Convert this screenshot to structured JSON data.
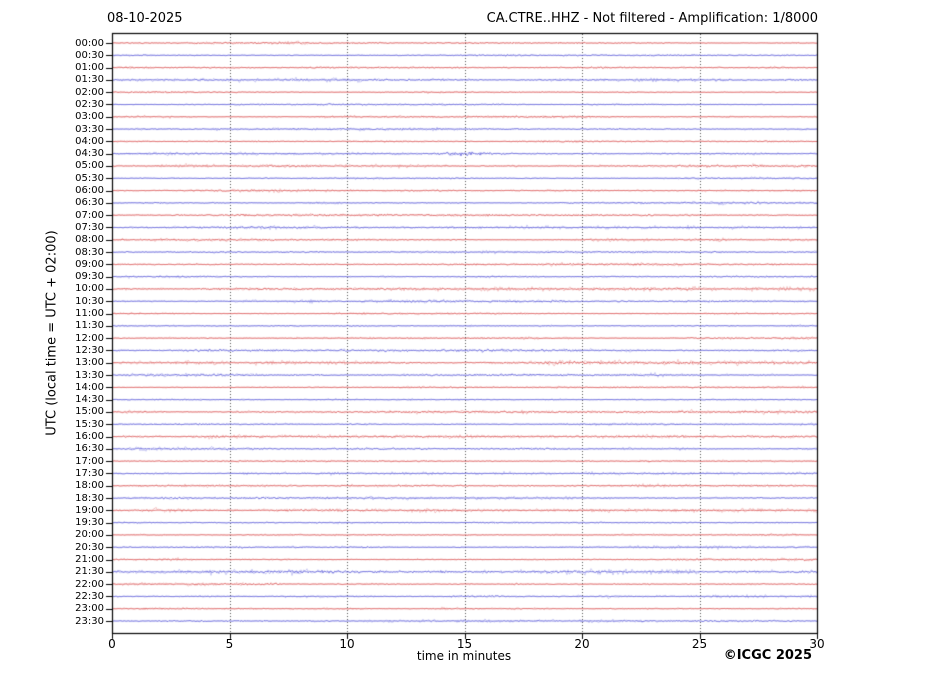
{
  "header": {
    "date": "08-10-2025",
    "station_info": "CA.CTRE..HHZ - Not filtered - Amplification: 1/8000"
  },
  "axes": {
    "y_label": "UTC (local time = UTC + 02:00)",
    "x_label": "time in minutes"
  },
  "footer": {
    "copyright": "©ICGC 2025"
  },
  "colors": {
    "trace_red": "#d94c4c",
    "trace_blue": "#5252d6",
    "grid": "#555555",
    "frame": "#000000",
    "background": "#ffffff"
  },
  "chart_data": {
    "type": "line",
    "subtype": "helicorder-dayplot",
    "x_range_minutes": [
      0,
      30
    ],
    "x_ticks": [
      0,
      5,
      10,
      15,
      20,
      25,
      30
    ],
    "grid_minutes": [
      5,
      10,
      15,
      20,
      25
    ],
    "minutes_per_row": 30,
    "legend_position": "none",
    "grid": "vertical-dotted",
    "rows": [
      {
        "label": "00:00",
        "color": "red",
        "amp": 1.0
      },
      {
        "label": "00:30",
        "color": "blue",
        "amp": 0.9
      },
      {
        "label": "01:00",
        "color": "red",
        "amp": 1.1
      },
      {
        "label": "01:30",
        "color": "blue",
        "amp": 1.25
      },
      {
        "label": "02:00",
        "color": "red",
        "amp": 1.0
      },
      {
        "label": "02:30",
        "color": "blue",
        "amp": 0.95
      },
      {
        "label": "03:00",
        "color": "red",
        "amp": 1.0
      },
      {
        "label": "03:30",
        "color": "blue",
        "amp": 1.0
      },
      {
        "label": "04:00",
        "color": "red",
        "amp": 0.95
      },
      {
        "label": "04:30",
        "color": "blue",
        "amp": 1.1
      },
      {
        "label": "05:00",
        "color": "red",
        "amp": 1.2
      },
      {
        "label": "05:30",
        "color": "blue",
        "amp": 0.8
      },
      {
        "label": "06:00",
        "color": "red",
        "amp": 1.1
      },
      {
        "label": "06:30",
        "color": "blue",
        "amp": 1.0
      },
      {
        "label": "07:00",
        "color": "red",
        "amp": 1.3
      },
      {
        "label": "07:30",
        "color": "blue",
        "amp": 1.1
      },
      {
        "label": "08:00",
        "color": "red",
        "amp": 1.05
      },
      {
        "label": "08:30",
        "color": "blue",
        "amp": 0.9
      },
      {
        "label": "09:00",
        "color": "red",
        "amp": 0.9
      },
      {
        "label": "09:30",
        "color": "blue",
        "amp": 1.0
      },
      {
        "label": "10:00",
        "color": "red",
        "amp": 1.3
      },
      {
        "label": "10:30",
        "color": "blue",
        "amp": 1.0
      },
      {
        "label": "11:00",
        "color": "red",
        "amp": 0.9
      },
      {
        "label": "11:30",
        "color": "blue",
        "amp": 1.0
      },
      {
        "label": "12:00",
        "color": "red",
        "amp": 1.0
      },
      {
        "label": "12:30",
        "color": "blue",
        "amp": 1.4
      },
      {
        "label": "13:00",
        "color": "red",
        "amp": 1.45
      },
      {
        "label": "13:30",
        "color": "blue",
        "amp": 1.1
      },
      {
        "label": "14:00",
        "color": "red",
        "amp": 0.7
      },
      {
        "label": "14:30",
        "color": "blue",
        "amp": 0.9
      },
      {
        "label": "15:00",
        "color": "red",
        "amp": 1.15
      },
      {
        "label": "15:30",
        "color": "blue",
        "amp": 1.0
      },
      {
        "label": "16:00",
        "color": "red",
        "amp": 1.1
      },
      {
        "label": "16:30",
        "color": "blue",
        "amp": 1.2
      },
      {
        "label": "17:00",
        "color": "red",
        "amp": 0.9
      },
      {
        "label": "17:30",
        "color": "blue",
        "amp": 1.0
      },
      {
        "label": "18:00",
        "color": "red",
        "amp": 1.0
      },
      {
        "label": "18:30",
        "color": "blue",
        "amp": 1.05
      },
      {
        "label": "19:00",
        "color": "red",
        "amp": 1.3
      },
      {
        "label": "19:30",
        "color": "blue",
        "amp": 1.0
      },
      {
        "label": "20:00",
        "color": "red",
        "amp": 0.7
      },
      {
        "label": "20:30",
        "color": "blue",
        "amp": 1.0
      },
      {
        "label": "21:00",
        "color": "red",
        "amp": 1.1
      },
      {
        "label": "21:30",
        "color": "blue",
        "amp": 1.8
      },
      {
        "label": "22:00",
        "color": "red",
        "amp": 1.3
      },
      {
        "label": "22:30",
        "color": "blue",
        "amp": 1.0
      },
      {
        "label": "23:00",
        "color": "red",
        "amp": 0.8
      },
      {
        "label": "23:30",
        "color": "blue",
        "amp": 1.0
      }
    ],
    "events": [
      {
        "row": "04:30",
        "minute": 15,
        "scale": 2.8,
        "width_min": 0.7
      }
    ]
  }
}
